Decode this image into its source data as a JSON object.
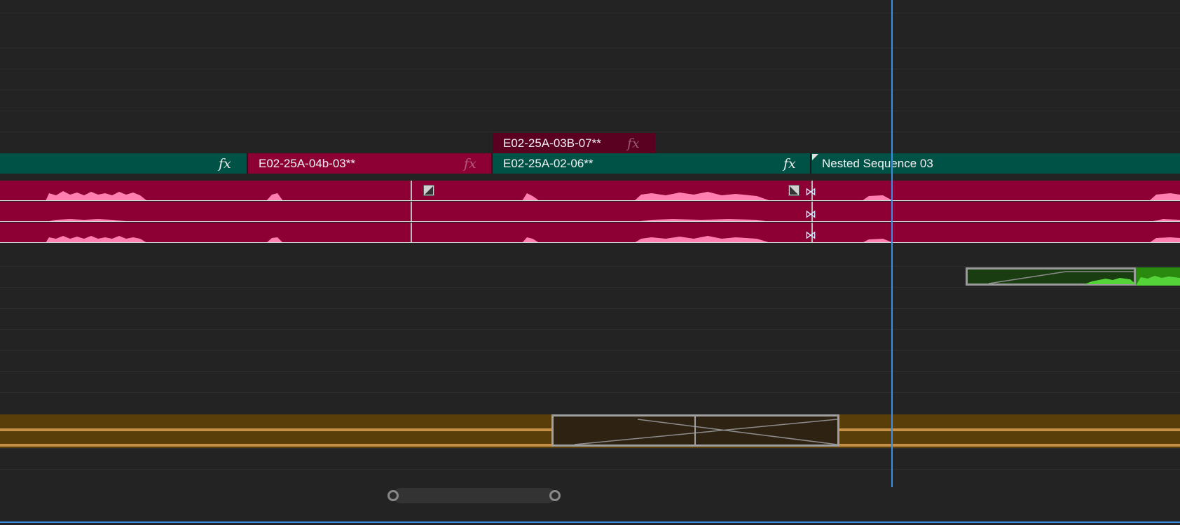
{
  "colors": {
    "video_teal": "#005247",
    "video_magenta": "#8c0033",
    "video_dark_magenta": "#5a0020",
    "audio_orange": "#5a3e0a",
    "audio_green": "#1c5c12",
    "playhead_blue": "#3a8ee6"
  },
  "timeline": {
    "video_top": {
      "clip_label": "E02-25A-03B-07**",
      "fx_label": "fx"
    },
    "video_main": {
      "clip_a_fx": "fx",
      "clip_b_label": "E02-25A-04b-03**",
      "clip_b_fx": "fx",
      "clip_c_label": "E02-25A-02-06**",
      "clip_c_fx": "fx",
      "clip_d_label": "Nested Sequence 03"
    },
    "transition_icons": [
      "cross-dissolve-icon",
      "cross-dissolve-icon"
    ],
    "bowtie_icons": [
      "⋈",
      "⋈",
      "⋈"
    ]
  }
}
